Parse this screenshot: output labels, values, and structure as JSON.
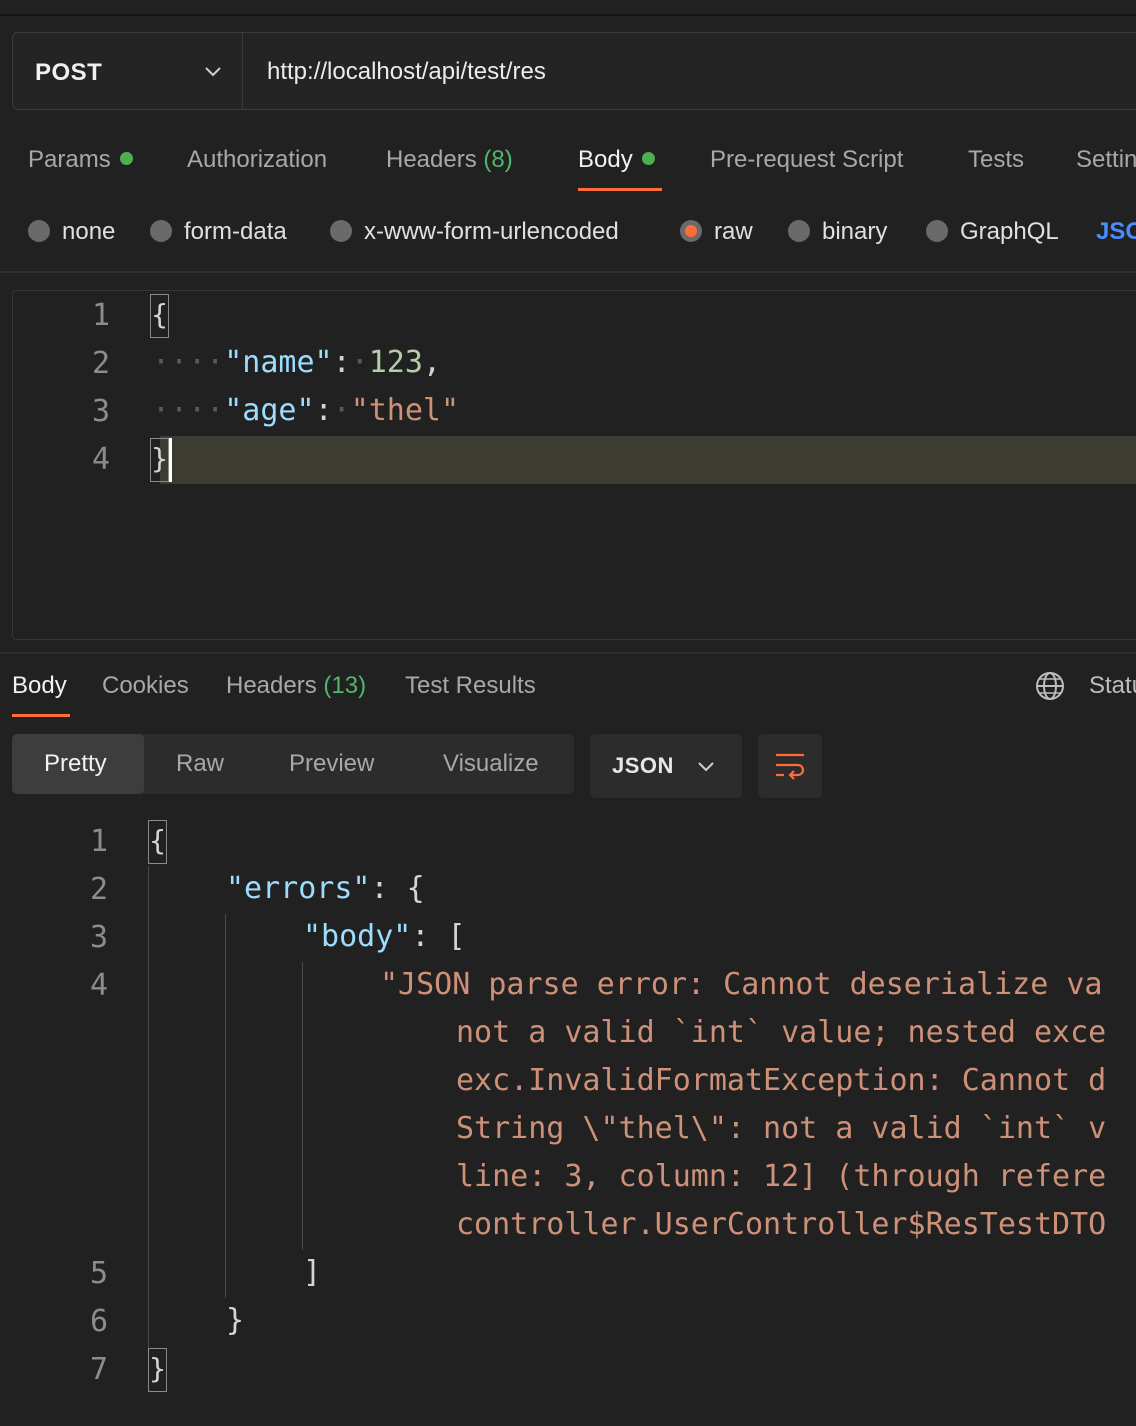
{
  "request": {
    "method": "POST",
    "url": "http://localhost/api/test/res"
  },
  "request_tabs": [
    {
      "label": "Params",
      "dot": true
    },
    {
      "label": "Authorization"
    },
    {
      "label": "Headers",
      "count": "(8)"
    },
    {
      "label": "Body",
      "dot": true,
      "active": true
    },
    {
      "label": "Pre-request Script"
    },
    {
      "label": "Tests"
    },
    {
      "label": "Settin"
    }
  ],
  "body_types": [
    {
      "label": "none"
    },
    {
      "label": "form-data"
    },
    {
      "label": "x-www-form-urlencoded"
    },
    {
      "label": "raw",
      "selected": true
    },
    {
      "label": "binary"
    },
    {
      "label": "GraphQL"
    }
  ],
  "body_language": "JSO",
  "request_body": {
    "line_numbers": [
      "1",
      "2",
      "3",
      "4"
    ],
    "open_brace": "{",
    "close_brace": "}",
    "indent": "····",
    "key1": "\"name\"",
    "val1": "123",
    "key2": "\"age\"",
    "val2": "\"thel\"",
    "colon": ":",
    "comma": ","
  },
  "response_tabs": [
    {
      "label": "Body",
      "active": true
    },
    {
      "label": "Cookies"
    },
    {
      "label": "Headers",
      "count": "(13)"
    },
    {
      "label": "Test Results"
    }
  ],
  "status_label": "Statu",
  "view_modes": [
    "Pretty",
    "Raw",
    "Preview",
    "Visualize"
  ],
  "active_view": "Pretty",
  "format": "JSON",
  "response_body": {
    "line_numbers": [
      "1",
      "2",
      "3",
      "4",
      "5",
      "6",
      "7"
    ],
    "open_brace": "{",
    "close_brace": "}",
    "errors_key": "\"errors\"",
    "body_key": "\"body\"",
    "open_bracket": "[",
    "close_bracket": "]",
    "error_lines": [
      "\"JSON parse error: Cannot deserialize va",
      "not a valid `int` value; nested exce",
      "exc.InvalidFormatException: Cannot d",
      "String \\\"thel\\\": not a valid `int` v",
      "line: 3, column: 12] (through refere",
      "controller.UserController$ResTestDTO"
    ]
  },
  "colors": {
    "accent": "#ff6c37",
    "status_green": "#4caf50",
    "json_key": "#9cdcfe",
    "json_number": "#b5cea8",
    "json_string": "#ce9178"
  }
}
